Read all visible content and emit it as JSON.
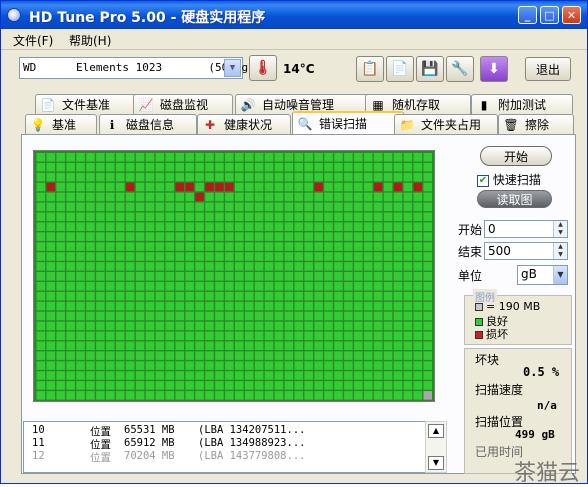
{
  "window": {
    "title": "HD Tune Pro 5.00 - 硬盘实用程序",
    "min": "_",
    "max": "□",
    "close": "✕"
  },
  "menu": {
    "file": "文件(F)",
    "help": "帮助(H)"
  },
  "toolbar": {
    "drive": "WD      Elements 1023       (500 gB)",
    "temperature": "14°C",
    "exit": "退出"
  },
  "tabs_top": [
    {
      "label": "文件基准",
      "icon": "document-icon"
    },
    {
      "label": "磁盘监视",
      "icon": "chart-icon"
    },
    {
      "label": "自动噪音管理",
      "icon": "speaker-icon"
    },
    {
      "label": "随机存取",
      "icon": "dots-icon"
    },
    {
      "label": "附加测试",
      "icon": "chart-bars-icon"
    }
  ],
  "tabs_bottom": [
    {
      "label": "基准",
      "icon": "bulb-icon"
    },
    {
      "label": "磁盘信息",
      "icon": "info-icon"
    },
    {
      "label": "健康状况",
      "icon": "cross-icon"
    },
    {
      "label": "错误扫描",
      "icon": "magnifier-icon",
      "active": true
    },
    {
      "label": "文件夹占用",
      "icon": "folder-icon"
    },
    {
      "label": "擦除",
      "icon": "trash-icon"
    }
  ],
  "scan": {
    "start_btn": "开始",
    "quick_scan_label": "快速扫描",
    "quick_scan_checked": true,
    "map_btn": "读取图",
    "start_label": "开始",
    "start_value": "0",
    "end_label": "结束",
    "end_value": "500",
    "unit_label": "单位",
    "unit_value": "gB",
    "legend_title": "图例",
    "legend_block": "= 190 MB",
    "legend_good": "良好",
    "legend_bad": "损坏",
    "damage_label": "坏块",
    "damage_value": "0.5 %",
    "speed_label": "扫描速度",
    "speed_value": "n/a",
    "position_label": "扫描位置",
    "position_value": "499 gB",
    "elapsed_label": "已用时间"
  },
  "grid": {
    "cols": 40,
    "rows": 25,
    "good_color": "#33cc33",
    "bad_color": "#b31b1b",
    "line_color": "#2b8a2b",
    "unscanned_color": "#a8a8a8",
    "bad_blocks": [
      [
        3,
        1
      ],
      [
        3,
        9
      ],
      [
        3,
        14
      ],
      [
        3,
        15
      ],
      [
        3,
        17
      ],
      [
        3,
        18
      ],
      [
        3,
        19
      ],
      [
        4,
        16
      ],
      [
        3,
        28
      ],
      [
        3,
        34
      ],
      [
        3,
        36
      ],
      [
        3,
        38
      ]
    ],
    "unscanned": [
      [
        24,
        39
      ]
    ]
  },
  "log": [
    {
      "n": "10",
      "pos": "位置",
      "mb": "65531 MB",
      "lba": "(LBA 134207511...",
      "dim": false
    },
    {
      "n": "11",
      "pos": "位置",
      "mb": "65912 MB",
      "lba": "(LBA 134988923...",
      "dim": false
    },
    {
      "n": "12",
      "pos": "位置",
      "mb": "70204 MB",
      "lba": "(LBA 143779808...",
      "dim": true
    }
  ],
  "watermark": "茶猫云"
}
